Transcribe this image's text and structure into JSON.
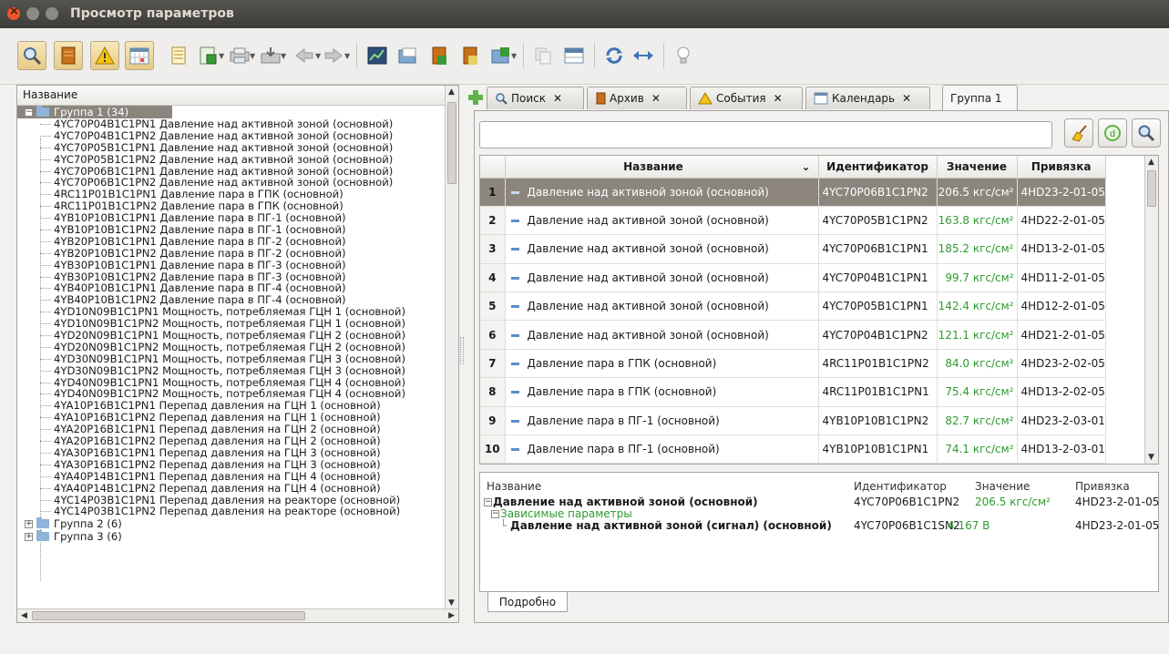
{
  "window": {
    "title": "Просмотр параметров"
  },
  "left_panel": {
    "header": "Название",
    "groups": [
      {
        "label": "Группа 1 (34)",
        "expanded": true,
        "selected": true
      },
      {
        "label": "Группа 2 (6)",
        "expanded": false
      },
      {
        "label": "Группа 3 (6)",
        "expanded": false
      }
    ],
    "items": [
      "4YC70P04B1C1PN1 Давление над активной зоной (основной)",
      "4YC70P04B1C1PN2 Давление над активной зоной (основной)",
      "4YC70P05B1C1PN1 Давление над активной зоной (основной)",
      "4YC70P05B1C1PN2 Давление над активной зоной (основной)",
      "4YC70P06B1C1PN1 Давление над активной зоной (основной)",
      "4YC70P06B1C1PN2 Давление над активной зоной (основной)",
      "4RC11P01B1C1PN1 Давление пара в ГПК (основной)",
      "4RC11P01B1C1PN2 Давление пара в ГПК (основной)",
      "4YB10P10B1C1PN1 Давление пара в ПГ-1 (основной)",
      "4YB10P10B1C1PN2 Давление пара в ПГ-1 (основной)",
      "4YB20P10B1C1PN1 Давление пара в ПГ-2 (основной)",
      "4YB20P10B1C1PN2 Давление пара в ПГ-2 (основной)",
      "4YB30P10B1C1PN1 Давление пара в ПГ-3 (основной)",
      "4YB30P10B1C1PN2 Давление пара в ПГ-3 (основной)",
      "4YB40P10B1C1PN1 Давление пара в ПГ-4 (основной)",
      "4YB40P10B1C1PN2 Давление пара в ПГ-4 (основной)",
      "4YD10N09B1C1PN1 Мощность, потребляемая ГЦН 1 (основной)",
      "4YD10N09B1C1PN2 Мощность, потребляемая ГЦН 1 (основной)",
      "4YD20N09B1C1PN1 Мощность, потребляемая ГЦН 2 (основной)",
      "4YD20N09B1C1PN2 Мощность, потребляемая ГЦН 2 (основной)",
      "4YD30N09B1C1PN1 Мощность, потребляемая ГЦН 3 (основной)",
      "4YD30N09B1C1PN2 Мощность, потребляемая ГЦН 3 (основной)",
      "4YD40N09B1C1PN1 Мощность, потребляемая ГЦН 4 (основной)",
      "4YD40N09B1C1PN2 Мощность, потребляемая ГЦН 4 (основной)",
      "4YA10P16B1C1PN1 Перепад давления на ГЦН 1 (основной)",
      "4YA10P16B1C1PN2 Перепад давления на ГЦН 1 (основной)",
      "4YA20P16B1C1PN1 Перепад давления на ГЦН 2 (основной)",
      "4YA20P16B1C1PN2 Перепад давления на ГЦН 2 (основной)",
      "4YA30P16B1C1PN1 Перепад давления на ГЦН 3 (основной)",
      "4YA30P16B1C1PN2 Перепад давления на ГЦН 3 (основной)",
      "4YA40P14B1C1PN1 Перепад давления на ГЦН 4 (основной)",
      "4YA40P14B1C1PN2 Перепад давления на ГЦН 4 (основной)",
      "4YC14P03B1C1PN1 Перепад давления на реакторе (основной)",
      "4YC14P03B1C1PN2 Перепад давления на реакторе (основной)"
    ]
  },
  "tabs": [
    {
      "label": "Поиск",
      "icon": "search-icon",
      "closable": true
    },
    {
      "label": "Архив",
      "icon": "archive-icon",
      "closable": true
    },
    {
      "label": "События",
      "icon": "warning-icon",
      "closable": true
    },
    {
      "label": "Календарь",
      "icon": "calendar-icon",
      "closable": true
    },
    {
      "label": "Группа 1",
      "closable": false,
      "active": true
    }
  ],
  "search": {
    "value": ""
  },
  "grid": {
    "columns": [
      "Название",
      "Идентификатор",
      "Значение",
      "Привязка"
    ],
    "rows": [
      {
        "n": "1",
        "name": "Давление над активной зоной (основной)",
        "id": "4YC70P06B1C1PN2",
        "value": "206.5 кгс/см²",
        "bind": "4HD23-2-01-05",
        "selected": true
      },
      {
        "n": "2",
        "name": "Давление над активной зоной (основной)",
        "id": "4YC70P05B1C1PN2",
        "value": "163.8 кгс/см²",
        "bind": "4HD22-2-01-05"
      },
      {
        "n": "3",
        "name": "Давление над активной зоной (основной)",
        "id": "4YC70P06B1C1PN1",
        "value": "185.2 кгс/см²",
        "bind": "4HD13-2-01-05"
      },
      {
        "n": "4",
        "name": "Давление над активной зоной (основной)",
        "id": "4YC70P04B1C1PN1",
        "value": "99.7 кгс/см²",
        "bind": "4HD11-2-01-05"
      },
      {
        "n": "5",
        "name": "Давление над активной зоной (основной)",
        "id": "4YC70P05B1C1PN1",
        "value": "142.4 кгс/см²",
        "bind": "4HD12-2-01-05"
      },
      {
        "n": "6",
        "name": "Давление над активной зоной (основной)",
        "id": "4YC70P04B1C1PN2",
        "value": "121.1 кгс/см²",
        "bind": "4HD21-2-01-05"
      },
      {
        "n": "7",
        "name": "Давление пара в ГПК (основной)",
        "id": "4RC11P01B1C1PN2",
        "value": "84.0 кгс/см²",
        "bind": "4HD23-2-02-05"
      },
      {
        "n": "8",
        "name": "Давление пара в ГПК (основной)",
        "id": "4RC11P01B1C1PN1",
        "value": "75.4 кгс/см²",
        "bind": "4HD13-2-02-05"
      },
      {
        "n": "9",
        "name": "Давление пара в ПГ-1 (основной)",
        "id": "4YB10P10B1C1PN2",
        "value": "82.7 кгс/см²",
        "bind": "4HD23-2-03-01"
      },
      {
        "n": "10",
        "name": "Давление пара в ПГ-1 (основной)",
        "id": "4YB10P10B1C1PN1",
        "value": "74.1 кгс/см²",
        "bind": "4HD13-2-03-01"
      }
    ]
  },
  "details": {
    "columns": [
      "Название",
      "Идентификатор",
      "Значение",
      "Привязка"
    ],
    "main": {
      "name": "Давление над активной зоной (основной)",
      "id": "4YC70P06B1C1PN2",
      "value": "206.5 кгс/см²",
      "bind": "4HD23-2-01-05"
    },
    "dependent_label": "Зависимые параметры",
    "dependent": {
      "name": "Давление над активной зоной (сигнал) (основной)",
      "id": "4YC70P06B1C1SN2",
      "value": "4.167 В",
      "bind": "4HD23-2-01-05"
    },
    "tab": "Подробно"
  },
  "colors": {
    "selection": "#8b857e",
    "value_green": "#2e9b2e",
    "titlebar": "#3d3c38"
  }
}
